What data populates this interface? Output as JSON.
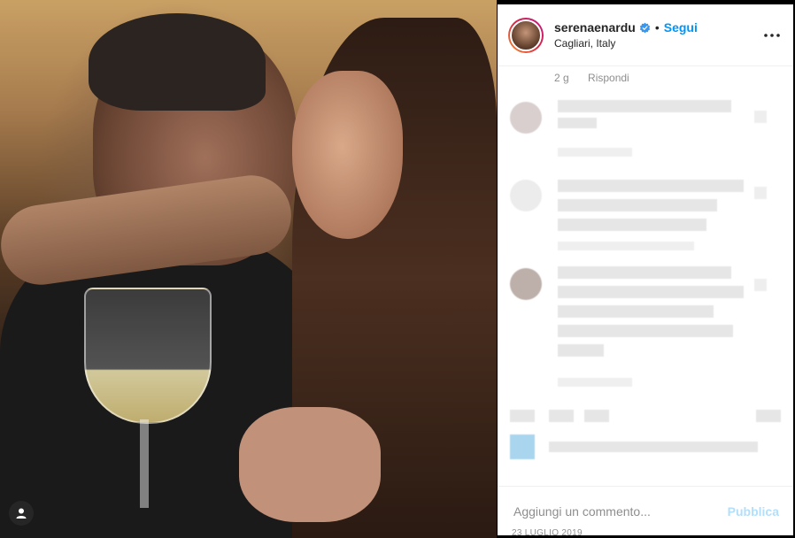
{
  "post": {
    "username": "serenaenardu",
    "verified": true,
    "follow_label": "Segui",
    "separator": "•",
    "location": "Cagliari, Italy",
    "date": "23 LUGLIO 2019"
  },
  "reply_meta": {
    "time": "2 g",
    "reply_label": "Rispondi"
  },
  "comment_box": {
    "placeholder": "Aggiungi un commento...",
    "publish_label": "Pubblica"
  },
  "colors": {
    "accent": "#0095f6",
    "publish_disabled": "#b2dffc",
    "muted": "#8e8e8e"
  },
  "icons": {
    "verified": "verified-badge-icon",
    "more": "more-options-icon",
    "user_tag": "user-tag-icon"
  }
}
